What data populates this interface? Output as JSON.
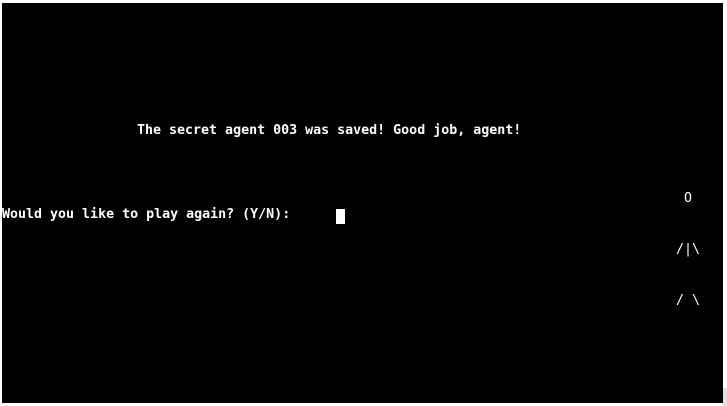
{
  "terminal": {
    "message": "The secret agent 003 was saved! Good job, agent!",
    "figure": {
      "head": " O",
      "body": "/|\\",
      "legs": "/ \\"
    },
    "prompt": "Would you like to play again? (Y/N): ",
    "input_value": ""
  },
  "colors": {
    "background": "#000000",
    "text": "#ffffff",
    "frame": "#ffffff"
  }
}
